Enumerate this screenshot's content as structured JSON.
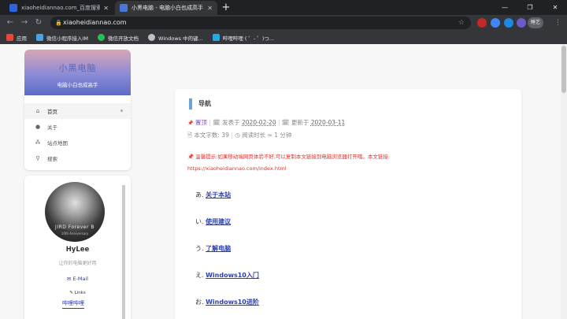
{
  "browser": {
    "tabs": [
      {
        "title": "xiaoheidiannao.com_百度搜索",
        "favicon_color": "#2f64e0"
      },
      {
        "title": "小黑电脑 - 电脑小白也成高手",
        "favicon_color": "#4a78d6"
      }
    ],
    "new_tab": "+",
    "window_controls": {
      "minimize": "—",
      "maximize": "❐",
      "close": "✕"
    },
    "nav": {
      "back": "←",
      "forward": "→",
      "reload": "↻"
    },
    "url": "xiaoheidiannao.com",
    "lock_icon": "🔒",
    "bookmark_star": "☆",
    "profile_label": "睡艺",
    "menu_icon": "⋮",
    "bookmarks": [
      {
        "label": "应用",
        "color": "#e8453c"
      },
      {
        "label": "微信小程序接入IM",
        "color": "#4aa3df"
      },
      {
        "label": "微信开放文档",
        "color": "#2dbd55"
      },
      {
        "label": "Windows 中的键...",
        "color": "#bdc1c6"
      },
      {
        "label": "哔哩哔哩 ( ゜- ゜)つ...",
        "color": "#2aa6e0"
      }
    ]
  },
  "sidebar": {
    "brand_title": "小黑电脑",
    "brand_subtitle": "电脑小白也成高手",
    "menu": [
      {
        "label": "首页",
        "icon": "home-icon",
        "glyph": "🏠"
      },
      {
        "label": "关于",
        "icon": "user-icon",
        "glyph": "👤"
      },
      {
        "label": "站点地图",
        "icon": "sitemap-icon",
        "glyph": "⁂"
      },
      {
        "label": "搜索",
        "icon": "search-icon",
        "glyph": "🔍"
      }
    ]
  },
  "author": {
    "avatar_text": "JIRD Forever B",
    "avatar_subtext": "10th Anniversary",
    "name": "HyLee",
    "description": "让你的电脑更好用",
    "email": "✉ E-Mail",
    "links": "✎ Links",
    "bilibili": "哔哩哔哩"
  },
  "post": {
    "title": "导航",
    "pin_label": "置顶",
    "published_prefix": "发表于",
    "published_date": "2020-02-20",
    "updated_prefix": "更新于",
    "updated_date": "2020-03-11",
    "wordcount_label": "本文字数:",
    "wordcount": "39",
    "readtime": "阅读时长 ≈ 1 分钟",
    "warning": "温馨提示:如果移动端网页体验不好,可以复制本文链接到电脑浏览器打开哦。本文链接:",
    "link": "https://xiaoheidiannao.com/index.html",
    "toc": [
      {
        "marker": "あ.",
        "label": "关于本站"
      },
      {
        "marker": "い.",
        "label": "使用建议"
      },
      {
        "marker": "う.",
        "label": "了解电脑"
      },
      {
        "marker": "え.",
        "label": "Windows10入门"
      },
      {
        "marker": "お.",
        "label": "Windows10进阶"
      }
    ]
  }
}
